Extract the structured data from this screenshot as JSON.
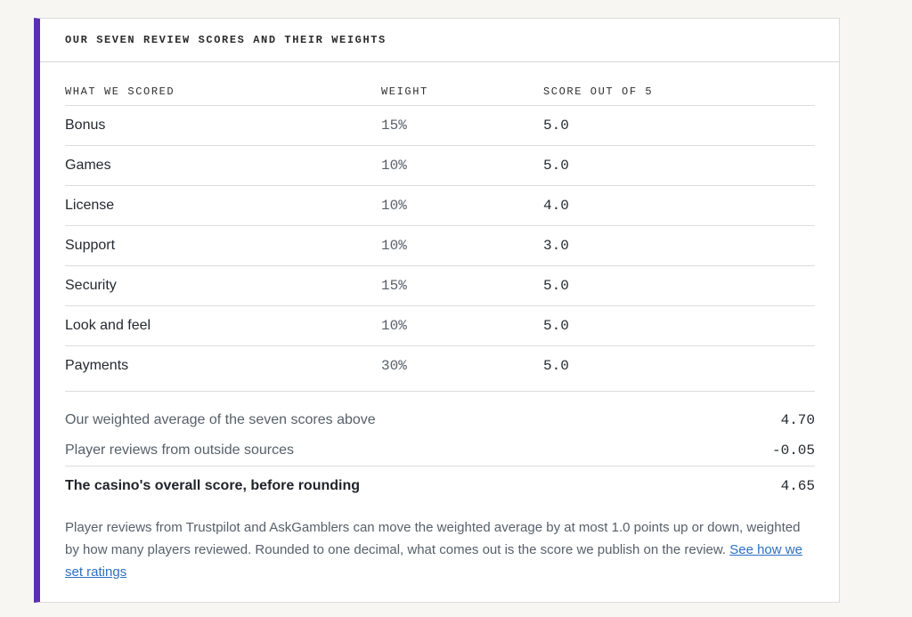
{
  "panel": {
    "title": "OUR SEVEN REVIEW SCORES AND THEIR WEIGHTS"
  },
  "table": {
    "headers": [
      "WHAT WE SCORED",
      "WEIGHT",
      "SCORE OUT OF 5"
    ],
    "rows": [
      {
        "name": "Bonus",
        "weight": "15%",
        "score": "5.0"
      },
      {
        "name": "Games",
        "weight": "10%",
        "score": "5.0"
      },
      {
        "name": "License",
        "weight": "10%",
        "score": "4.0"
      },
      {
        "name": "Support",
        "weight": "10%",
        "score": "3.0"
      },
      {
        "name": "Security",
        "weight": "15%",
        "score": "5.0"
      },
      {
        "name": "Look and feel",
        "weight": "10%",
        "score": "5.0"
      },
      {
        "name": "Payments",
        "weight": "30%",
        "score": "5.0"
      }
    ]
  },
  "summary": {
    "weighted_label": "Our weighted average of the seven scores above",
    "weighted_value": "4.70",
    "player_label": "Player reviews from outside sources",
    "player_value": "-0.05",
    "overall_label": "The casino's overall score, before rounding",
    "overall_value": "4.65"
  },
  "note": {
    "text": "Player reviews from Trustpilot and AskGamblers can move the weighted average by at most 1.0 points up or down, weighted by how many players reviewed. Rounded to one decimal, what comes out is the score we publish on the review.",
    "link_text": "See how we set ratings"
  },
  "colors": {
    "accent": "#5c2fb0",
    "link": "#2d6fc1",
    "background": "#f7f6f3"
  }
}
